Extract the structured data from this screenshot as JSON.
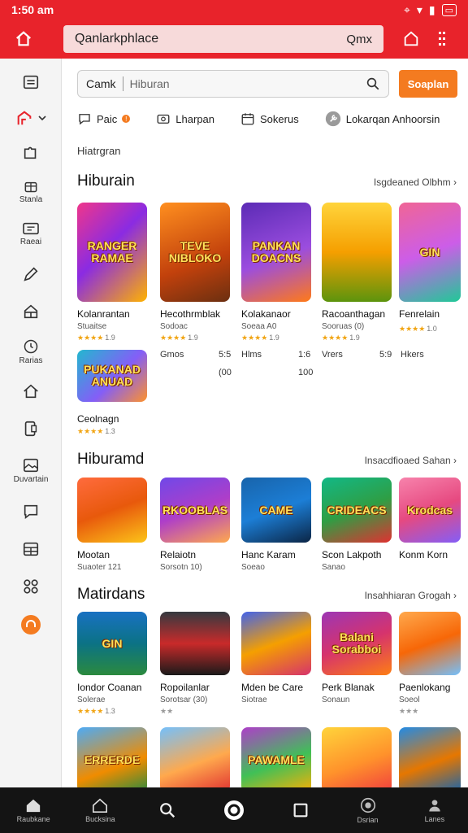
{
  "status_bar": {
    "time": "1:50 am"
  },
  "app_bar": {
    "url_text": "Qanlarkphlace",
    "url_right": "Qmx"
  },
  "sidebar": {
    "items": [
      {
        "icon": "list-icon",
        "label": ""
      },
      {
        "icon": "store-icon",
        "label": ""
      },
      {
        "icon": "puzzle-icon",
        "label": ""
      },
      {
        "icon": "gift-icon",
        "label": "Stanla"
      },
      {
        "icon": "ticket-icon",
        "label": "Raeai"
      },
      {
        "icon": "pencil-icon",
        "label": ""
      },
      {
        "icon": "shop-icon",
        "label": ""
      },
      {
        "icon": "clock-icon",
        "label": "Rarias"
      },
      {
        "icon": "home-icon",
        "label": ""
      },
      {
        "icon": "phone-icon",
        "label": ""
      },
      {
        "icon": "image-icon",
        "label": "Duvartain"
      },
      {
        "icon": "chat-icon",
        "label": ""
      },
      {
        "icon": "grid-icon",
        "label": ""
      },
      {
        "icon": "apps-icon",
        "label": ""
      },
      {
        "icon": "headset-icon",
        "label": ""
      }
    ]
  },
  "search": {
    "category": "Camk",
    "placeholder": "Hiburan",
    "button": "Soaplan"
  },
  "filters": [
    {
      "icon": "chat-icon",
      "label": "Paic"
    },
    {
      "icon": "camera-icon",
      "label": "Lharpan"
    },
    {
      "icon": "calendar-icon",
      "label": "Sokerus"
    },
    {
      "icon": "tool-icon",
      "label": "Lokarqan Anhoorsin"
    }
  ],
  "breadcrumb": "Hiatrgran",
  "sections": [
    {
      "title": "Hiburain",
      "link": "Isgdeaned Olbhm",
      "cards": [
        {
          "art": "RANGER RAMAE",
          "name": "Kolanrantan",
          "sub": "Stuaitse",
          "stars": "★★★★",
          "rating": "1.9"
        },
        {
          "art": "TEVE NIBLOKO",
          "name": "Hecothrmblak",
          "sub": "Sodoac",
          "stars": "★★★★",
          "rating": "1.9"
        },
        {
          "art": "PANKAN DOACNS",
          "name": "Kolakanaor",
          "sub": "Soeaa A0",
          "stars": "★★★★",
          "rating": "1.9"
        },
        {
          "art": "",
          "name": "Racoanthagan",
          "sub": "Sooruas (0)",
          "stars": "★★★★",
          "rating": "1.9"
        },
        {
          "art": "GIN",
          "name": "Fenrelain",
          "sub": "",
          "stars": "★★★★",
          "rating": "1.0"
        },
        {
          "art": "PUKANAD ANUAD",
          "name": "Ceolnagn",
          "sub": "",
          "stars": "★★★★",
          "rating": "1.3"
        }
      ],
      "mini_stats": [
        {
          "label": "Gmos",
          "value": "5:5",
          "value2": "(00"
        },
        {
          "label": "Hlms",
          "value": "1:6",
          "value2": "100"
        },
        {
          "label": "Vrers",
          "value": "5:9",
          "value2": ""
        },
        {
          "label": "Hkers",
          "value": "",
          "value2": ""
        }
      ]
    },
    {
      "title": "Hiburamd",
      "link": "Insacdfioaed Sahan",
      "cards": [
        {
          "art": "",
          "name": "Mootan",
          "sub": "Suaoter 121",
          "stars": "",
          "rating": ""
        },
        {
          "art": "RKOOBLAS",
          "name": "Relaiotn",
          "sub": "Sorsotn 10)",
          "stars": "",
          "rating": ""
        },
        {
          "art": "CAME",
          "name": "Hanc Karam",
          "sub": "Soeao",
          "stars": "",
          "rating": ""
        },
        {
          "art": "CRIDEACS",
          "name": "Scon Lakpoth",
          "sub": "Sanao",
          "stars": "",
          "rating": ""
        },
        {
          "art": "Krodcas",
          "name": "Konm Korn",
          "sub": "",
          "stars": "",
          "rating": ""
        }
      ]
    },
    {
      "title": "Matirdans",
      "link": "Insahhiaran Grogah",
      "cards": [
        {
          "art": "GIN",
          "name": "Iondor Coanan",
          "sub": "Solerae",
          "stars": "★★★★",
          "rating": "1.3"
        },
        {
          "art": "",
          "name": "Ropoilanlar",
          "sub": "Sorotsar (30)",
          "stars": "★★",
          "rating": ""
        },
        {
          "art": "",
          "name": "Mden be Care",
          "sub": "Siotrae",
          "stars": "",
          "rating": ""
        },
        {
          "art": "Balani Sorabboi",
          "name": "Perk Blanak",
          "sub": "Sonaun",
          "stars": "",
          "rating": ""
        },
        {
          "art": "",
          "name": "Paenlokang",
          "sub": "Soeol",
          "stars": "★★★",
          "rating": ""
        }
      ]
    }
  ],
  "row4": [
    {
      "art": "ERRERDE"
    },
    {
      "art": ""
    },
    {
      "art": "PAWAMLE"
    },
    {
      "art": ""
    },
    {
      "art": ""
    }
  ],
  "bottom_nav": [
    {
      "icon": "home-icon",
      "label": "Raubkane"
    },
    {
      "icon": "house-icon",
      "label": "Bucksina"
    },
    {
      "icon": "search-icon",
      "label": ""
    },
    {
      "icon": "circle-icon",
      "label": ""
    },
    {
      "icon": "square-icon",
      "label": ""
    },
    {
      "icon": "camera-icon",
      "label": "Dsrian"
    },
    {
      "icon": "person-icon",
      "label": "Lanes"
    }
  ],
  "colors": {
    "brand_red": "#e8232b",
    "accent_orange": "#f47b20",
    "nav_dark": "#141414"
  }
}
